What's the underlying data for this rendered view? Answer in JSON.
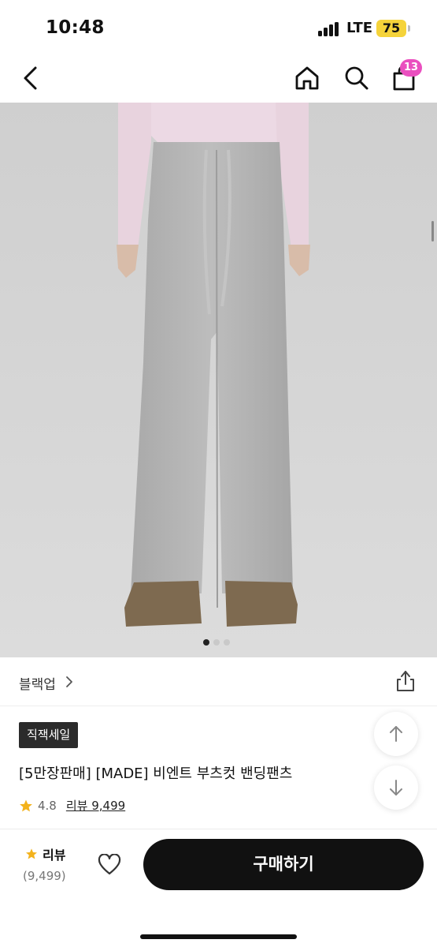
{
  "status": {
    "time": "10:48",
    "network": "LTE",
    "battery": "75"
  },
  "nav": {
    "cart_count": "13"
  },
  "gallery": {
    "total": 3,
    "active_index": 0
  },
  "product": {
    "brand": "블랙업",
    "badge": "직잭세일",
    "title": "[5만장판매] [MADE] 비엔트 부츠컷 밴딩팬츠",
    "rating": "4.8",
    "review_link": "리뷰 9,499"
  },
  "bottom": {
    "review_label": "리뷰",
    "review_count": "(9,499)",
    "buy_label": "구매하기"
  },
  "colors": {
    "accent_badge": "#ea4fbf",
    "star": "#f3b21c",
    "battery": "#f5d33a"
  }
}
